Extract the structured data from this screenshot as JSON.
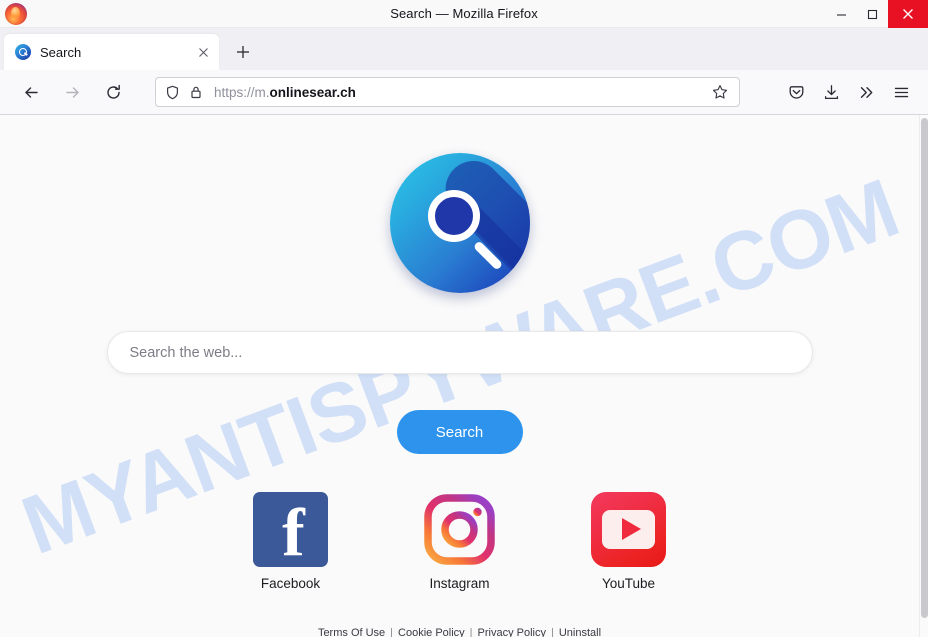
{
  "window": {
    "title": "Search — Mozilla Firefox",
    "app_icon": "firefox-logo-icon",
    "controls": {
      "minimize_label": "Minimize",
      "maximize_label": "Maximize",
      "close_label": "Close",
      "close_color": "#e81123"
    }
  },
  "tabstrip": {
    "tabs": [
      {
        "title": "Search",
        "favicon": "search-globe-favicon",
        "close_label": "Close tab"
      }
    ],
    "new_tab_label": "Open a new tab"
  },
  "navbar": {
    "back_label": "Go back one page",
    "forward_label": "Go forward one page",
    "reload_label": "Reload current page",
    "url": {
      "scheme": "https://m.",
      "host": "onlinesear.ch",
      "full": "https://m.onlinesear.ch",
      "shield_icon": "tracking-protection-shield-icon",
      "lock_icon": "padlock-icon"
    },
    "bookmark_label": "Bookmark this page",
    "right_icons": [
      {
        "name": "pocket-icon",
        "label": "Save to Pocket"
      },
      {
        "name": "download-icon",
        "label": "Downloads"
      },
      {
        "name": "chevron-double-right-icon",
        "label": "More tools"
      },
      {
        "name": "hamburger-menu-icon",
        "label": "Open application menu"
      }
    ]
  },
  "page": {
    "watermark": "MYANTISPYWARE.COM",
    "watermark_color": "#ccdcf7",
    "logo": {
      "name": "onlinesearch-magnifier-logo",
      "gradient_from": "#2ec4e6",
      "gradient_to": "#1d3fb5"
    },
    "search": {
      "placeholder": "Search the web...",
      "value": "",
      "button_label": "Search",
      "button_color": "#2e93ec"
    },
    "shortcuts": [
      {
        "label": "Facebook",
        "icon": "facebook-icon",
        "color": "#3b5998"
      },
      {
        "label": "Instagram",
        "icon": "instagram-icon",
        "color": "#d6249f"
      },
      {
        "label": "YouTube",
        "icon": "youtube-icon",
        "color": "#ee2a35"
      }
    ],
    "footer": {
      "links": [
        "Terms Of Use",
        "Cookie Policy",
        "Privacy Policy",
        "Uninstall"
      ],
      "separator": "|"
    },
    "background": "#fafafa"
  }
}
